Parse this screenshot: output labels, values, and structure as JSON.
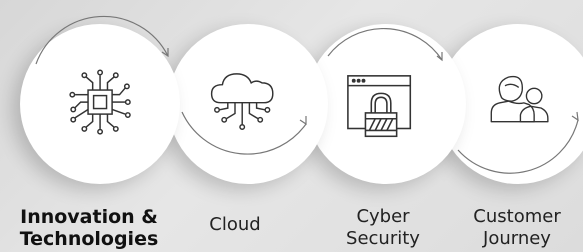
{
  "items": [
    {
      "label": "Innovation &\nTechnologies",
      "icon": "chip-icon",
      "active": true
    },
    {
      "label": "Cloud",
      "icon": "cloud-icon",
      "active": false
    },
    {
      "label": "Cyber\nSecurity",
      "icon": "browser-lock-icon",
      "active": false
    },
    {
      "label": "Customer\nJourney",
      "icon": "customers-icon",
      "active": false
    }
  ],
  "colors": {
    "line": "#555555",
    "circle": "#ffffff",
    "text": "#222222"
  }
}
